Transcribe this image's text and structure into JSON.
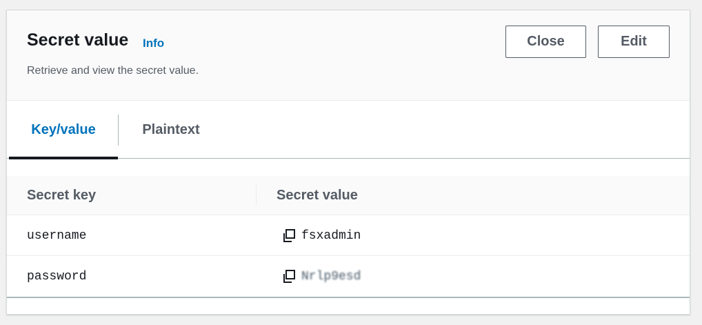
{
  "header": {
    "title": "Secret value",
    "info_link": "Info",
    "description": "Retrieve and view the secret value.",
    "close_label": "Close",
    "edit_label": "Edit"
  },
  "tabs": [
    {
      "label": "Key/value",
      "selected": true
    },
    {
      "label": "Plaintext",
      "selected": false
    }
  ],
  "table": {
    "columns": [
      "Secret key",
      "Secret value"
    ],
    "rows": [
      {
        "key": "username",
        "value": "fsxadmin",
        "copy_icon": "copy-icon"
      },
      {
        "key": "password",
        "value": "Nrlp9esd",
        "copy_icon": "copy-icon",
        "obscured": true
      }
    ]
  },
  "colors": {
    "accent": "#0073bb",
    "text": "#16191f",
    "muted": "#545b64",
    "border": "#aab7b8"
  }
}
